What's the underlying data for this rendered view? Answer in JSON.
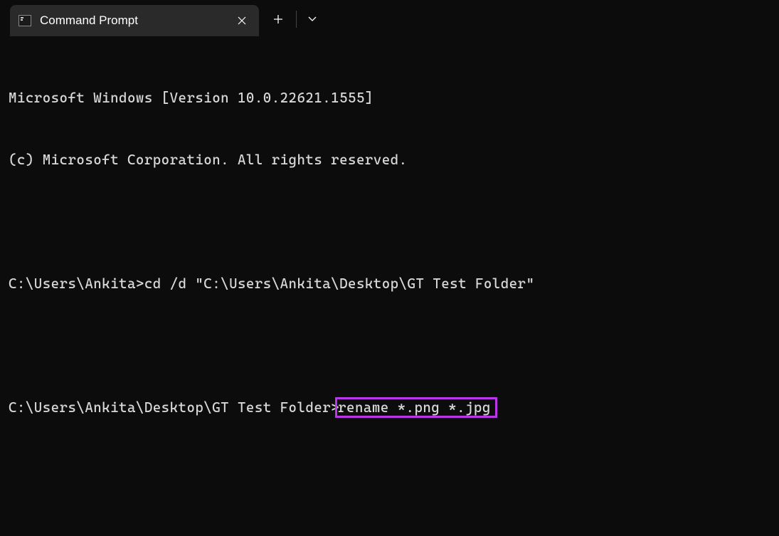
{
  "tab": {
    "title": "Command Prompt"
  },
  "terminal": {
    "line1": "Microsoft Windows [Version 10.0.22621.1555]",
    "line2": "(c) Microsoft Corporation. All rights reserved.",
    "blank1": "",
    "prompt1": "C:\\Users\\Ankita>",
    "command1": "cd /d \"C:\\Users\\Ankita\\Desktop\\GT Test Folder\"",
    "blank2": "",
    "prompt2": "C:\\Users\\Ankita\\Desktop\\GT Test Folder>",
    "command2": "rename *.png *.jpg"
  }
}
